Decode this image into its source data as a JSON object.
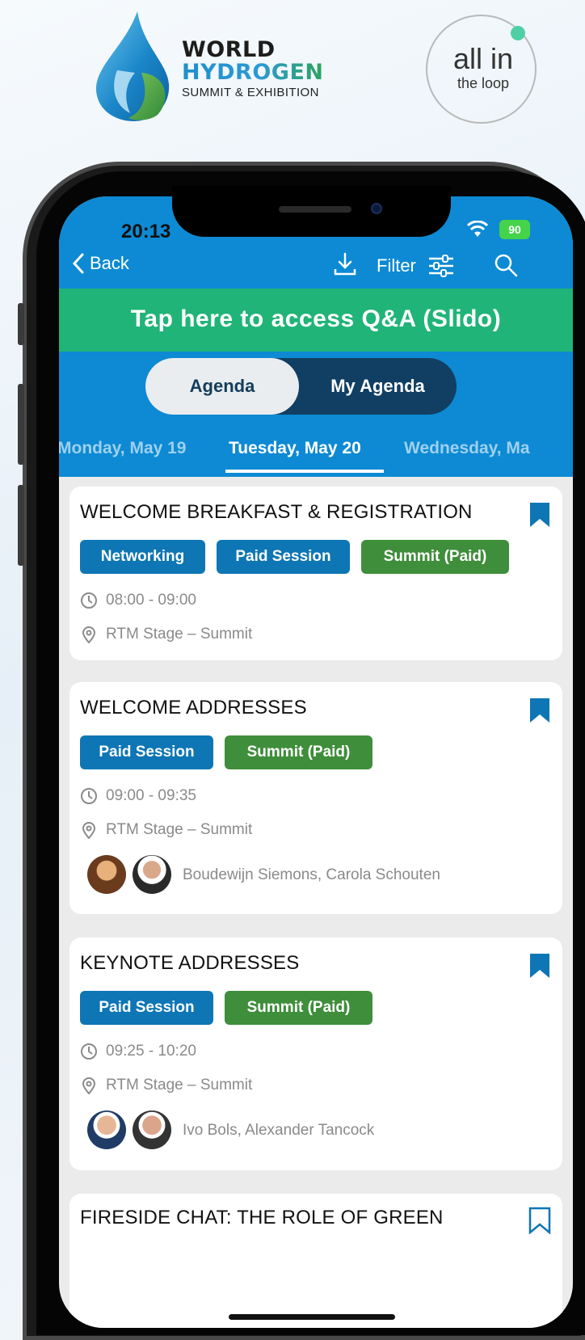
{
  "logos": {
    "summit": {
      "line1": "WORLD",
      "line2": "HYDROGEN",
      "line3": "SUMMIT & EXHIBITION"
    },
    "loop": {
      "line1": "all in",
      "line2": "the loop"
    }
  },
  "status_bar": {
    "time": "20:13",
    "battery": "90"
  },
  "header": {
    "back_label": "Back",
    "filter_label": "Filter",
    "slido_banner": "Tap here to access Q&A (Slido)"
  },
  "segment": {
    "agenda": "Agenda",
    "my_agenda": "My Agenda",
    "selected": "Agenda"
  },
  "days": [
    "Monday, May 19",
    "Tuesday, May 20",
    "Wednesday, Ma"
  ],
  "sessions": [
    {
      "title": "WELCOME BREAKFAST & REGISTRATION",
      "tags": [
        "Networking",
        "Paid Session",
        "Summit (Paid)"
      ],
      "time": "08:00 - 09:00",
      "location": "RTM Stage – Summit",
      "speakers": ""
    },
    {
      "title": "WELCOME ADDRESSES",
      "tags": [
        "Paid Session",
        "Summit (Paid)"
      ],
      "time": "09:00 - 09:35",
      "location": "RTM Stage – Summit",
      "speakers": "Boudewijn Siemons, Carola Schouten"
    },
    {
      "title": "KEYNOTE ADDRESSES",
      "tags": [
        "Paid Session",
        "Summit (Paid)"
      ],
      "time": "09:25 - 10:20",
      "location": "RTM Stage – Summit",
      "speakers": "Ivo Bols, Alexander Tancock"
    },
    {
      "title": "FIRESIDE CHAT: THE ROLE OF GREEN"
    }
  ],
  "colors": {
    "header_blue": "#0d8ad3",
    "slido_green": "#20b478",
    "tag_blue": "#0e76b4",
    "tag_green": "#3f8e3b"
  }
}
